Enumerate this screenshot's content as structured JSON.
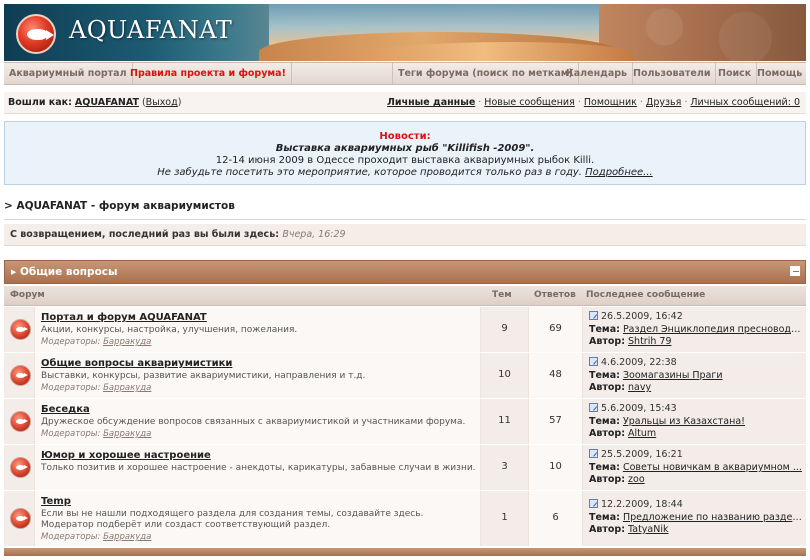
{
  "header": {
    "logo_text": "AQUAFANAT"
  },
  "nav": {
    "portal": "Аквариумный портал",
    "rules": "Правила проекта и форума!",
    "tags": "Теги форума (поиск по меткам)",
    "calendar": "Календарь",
    "users": "Пользователи",
    "search": "Поиск",
    "help": "Помощь"
  },
  "userbar": {
    "logged_as_label": "Вошли как:",
    "username": "AQUAFANAT",
    "logout": "Выход",
    "links": [
      "Личные данные",
      "Новые сообщения",
      "Помощник",
      "Друзья",
      "Личных сообщений: 0"
    ]
  },
  "news": {
    "heading": "Новости:",
    "title": "Выставка аквариумных рыб \"Killifish -2009\".",
    "line1": "12-14 июня 2009 в Одессе проходит выставка аквариумных рыбок Killi.",
    "line2": "Не забудьте посетить это мероприятие, которое проводится только раз в году.",
    "more": "Подробнее..."
  },
  "breadcrumb": {
    "prefix": ">",
    "title": "AQUAFANAT - форум аквариумистов"
  },
  "welcome": {
    "text": "С возвращением, последний раз вы были здесь:",
    "when": "Вчера, 16:29"
  },
  "category": {
    "title": "Общие вопросы"
  },
  "columns": {
    "forum": "Форум",
    "topics": "Тем",
    "posts": "Ответов",
    "last": "Последнее сообщение"
  },
  "labels": {
    "moderators": "Модераторы:",
    "topic": "Тема:",
    "author": "Автор:"
  },
  "forums": [
    {
      "name": "Портал и форум AQUAFANAT",
      "desc": "Акции, конкурсы, настройка, улучшения, пожелания.",
      "desc2": "",
      "moderator_label": "Модераторы:",
      "moderator": "Барракуда",
      "topics": "9",
      "posts": "69",
      "last_date": "26.5.2009, 16:42",
      "last_topic": "Раздел Энциклопедия пресноводн...",
      "last_author": "Shtrih 79"
    },
    {
      "name": "Общие вопросы аквариумистики",
      "desc": "Выставки, конкурсы, развитие аквариумистики, направления и т.д.",
      "desc2": "",
      "moderator_label": "Модераторы:",
      "moderator": "Барракуда",
      "topics": "10",
      "posts": "48",
      "last_date": "4.6.2009, 22:38",
      "last_topic": "Зоомагазины Праги",
      "last_author": "navy"
    },
    {
      "name": "Беседка",
      "desc": "Дружеское обсуждение вопросов связанных с аквариумистикой и участниками форума.",
      "desc2": "",
      "moderator_label": "Модераторы:",
      "moderator": "Барракуда",
      "topics": "11",
      "posts": "57",
      "last_date": "5.6.2009, 15:43",
      "last_topic": "Уральцы из Казахстана!",
      "last_author": "Altum"
    },
    {
      "name": "Юмор и хорошее настроение",
      "desc": "Только позитив и хорошее настроение - анекдоты, карикатуры, забавные случаи в жизни.",
      "desc2": "",
      "moderator_label": "",
      "moderator": "",
      "topics": "3",
      "posts": "10",
      "last_date": "25.5.2009, 16:21",
      "last_topic": "Советы новичкам в аквариумном ...",
      "last_author": "zoo"
    },
    {
      "name": "Temp",
      "desc": "Если вы не нашли подходящего раздела для создания темы, создавайте здесь.",
      "desc2": "Модератор подберёт или создаст соответствующий раздел.",
      "moderator_label": "Модераторы:",
      "moderator": "Барракуда",
      "topics": "1",
      "posts": "6",
      "last_date": "12.2.2009, 18:44",
      "last_topic": "Предложение по названию раздела...",
      "last_author": "TatyaNik"
    }
  ]
}
